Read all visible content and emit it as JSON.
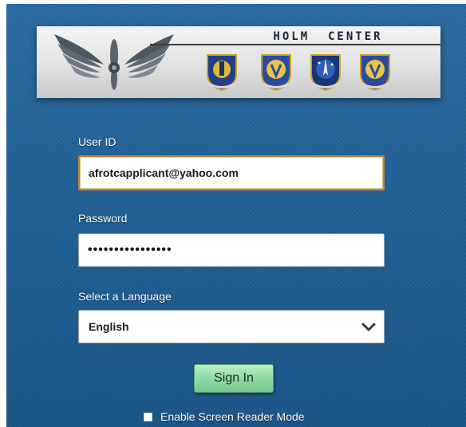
{
  "banner": {
    "title": "HOLM  CENTER",
    "logo_icon": "winged-propeller-emblem",
    "seals": [
      "holm-center-seal",
      "afrotc-seal",
      "afjrotc-seal",
      "ots-seal"
    ]
  },
  "form": {
    "user_id": {
      "label": "User ID",
      "value": "afrotcapplicant@yahoo.com"
    },
    "password": {
      "label": "Password",
      "value": "••••••••••••••••"
    },
    "language": {
      "label": "Select a Language",
      "selected": "English",
      "icon": "chevron-down-icon"
    },
    "sign_in_label": "Sign In",
    "screen_reader_label": "Enable Screen Reader Mode"
  },
  "colors": {
    "panel_blue": "#1f5f95",
    "button_green": "#8fdaa5",
    "focus_border": "#b9893f"
  }
}
